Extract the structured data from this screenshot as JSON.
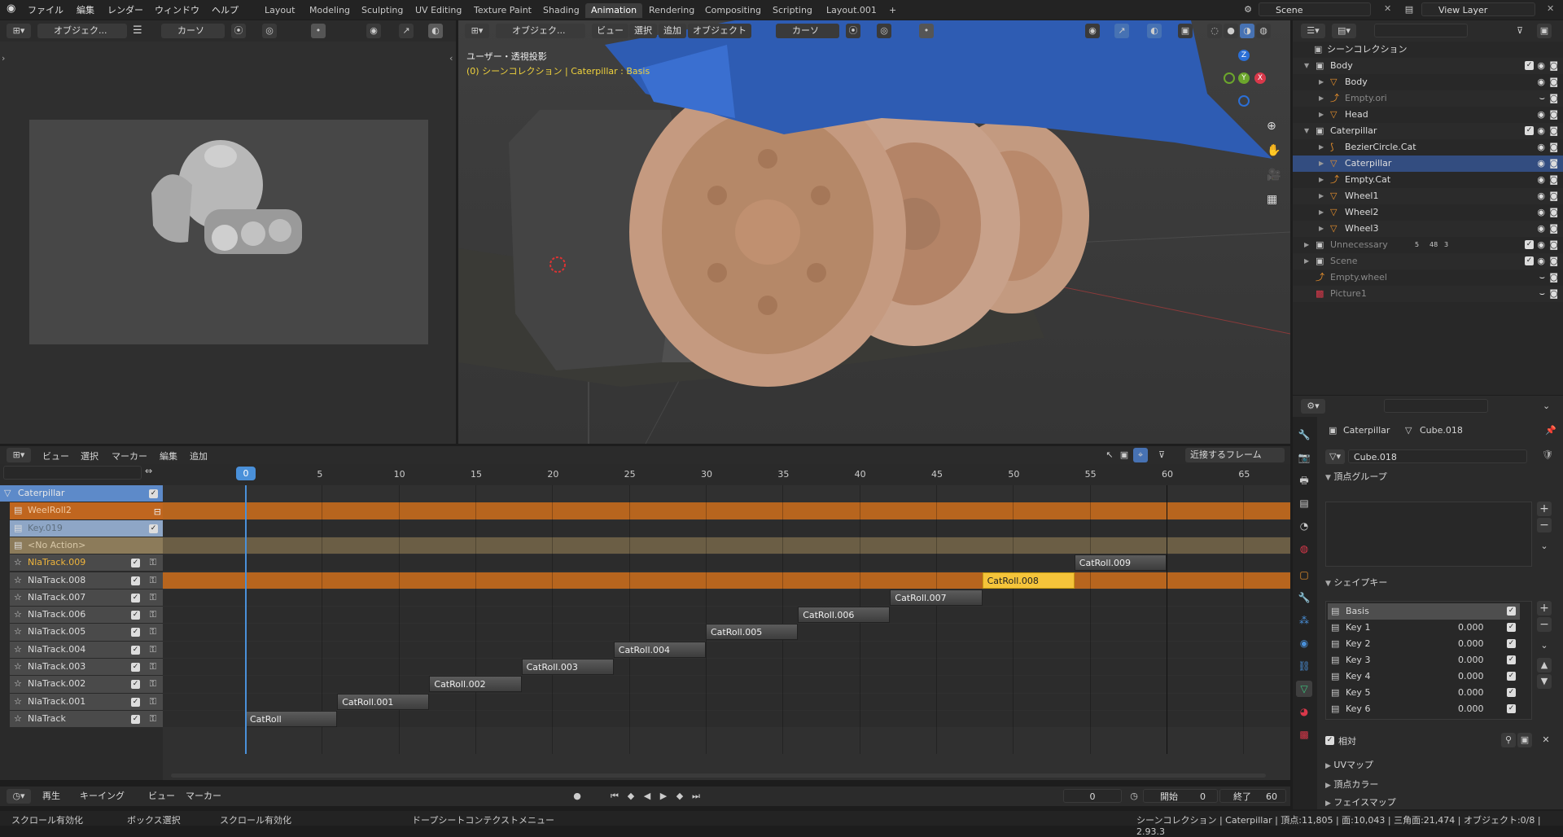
{
  "topbar": {
    "menus": [
      "ファイル",
      "編集",
      "レンダー",
      "ウィンドウ",
      "ヘルプ"
    ],
    "workspaces": [
      "Layout",
      "Modeling",
      "Sculpting",
      "UV Editing",
      "Texture Paint",
      "Shading",
      "Animation",
      "Rendering",
      "Compositing",
      "Scripting",
      "Layout.001"
    ],
    "active_workspace": "Animation",
    "add_tab": "+",
    "scene": "Scene",
    "view_layer": "View Layer"
  },
  "camera_view": {
    "mode": "オブジェク...",
    "pivot": "カーソ"
  },
  "viewport": {
    "mode": "オブジェク...",
    "menus": [
      "ビュー",
      "選択",
      "追加",
      "オブジェクト"
    ],
    "pivot": "カーソ",
    "overlay_title": "ユーザー・透視投影",
    "overlay_sub": "(0) シーンコレクション | Caterpillar : Basis",
    "gizmo": {
      "z": "Z",
      "x": "X",
      "y": "Y"
    }
  },
  "outliner": {
    "search_placeholder": "",
    "root": "シーンコレクション",
    "rows": [
      {
        "label": "Body",
        "level": 1,
        "type": "collection",
        "expanded": true
      },
      {
        "label": "Body",
        "level": 2,
        "type": "mesh"
      },
      {
        "label": "Empty.ori",
        "level": 2,
        "type": "empty",
        "dim": true
      },
      {
        "label": "Head",
        "level": 2,
        "type": "mesh"
      },
      {
        "label": "Caterpillar",
        "level": 1,
        "type": "collection",
        "expanded": true
      },
      {
        "label": "BezierCircle.Cat",
        "level": 2,
        "type": "curve"
      },
      {
        "label": "Caterpillar",
        "level": 2,
        "type": "mesh",
        "active": true
      },
      {
        "label": "Empty.Cat",
        "level": 2,
        "type": "empty"
      },
      {
        "label": "Wheel1",
        "level": 2,
        "type": "mesh"
      },
      {
        "label": "Wheel2",
        "level": 2,
        "type": "mesh"
      },
      {
        "label": "Wheel3",
        "level": 2,
        "type": "mesh"
      },
      {
        "label": "Unnecessary",
        "level": 1,
        "type": "collection",
        "dim": true,
        "badges": [
          "5",
          "48",
          "3"
        ]
      },
      {
        "label": "Scene",
        "level": 1,
        "type": "collection",
        "dim": true
      },
      {
        "label": "Empty.wheel",
        "level": 1,
        "type": "empty",
        "dim": true
      },
      {
        "label": "Picture1",
        "level": 1,
        "type": "image",
        "dim": true
      }
    ]
  },
  "properties": {
    "breadcrumb_object": "Caterpillar",
    "breadcrumb_data": "Cube.018",
    "mesh_name": "Cube.018",
    "vertex_groups": "頂点グループ",
    "shape_keys": "シェイプキー",
    "keys": [
      {
        "name": "Basis",
        "value": ""
      },
      {
        "name": "Key 1",
        "value": "0.000"
      },
      {
        "name": "Key 2",
        "value": "0.000"
      },
      {
        "name": "Key 3",
        "value": "0.000"
      },
      {
        "name": "Key 4",
        "value": "0.000"
      },
      {
        "name": "Key 5",
        "value": "0.000"
      },
      {
        "name": "Key 6",
        "value": "0.000"
      }
    ],
    "relative": "相対",
    "uv_maps": "UVマップ",
    "vertex_colors": "頂点カラー",
    "face_maps": "フェイスマップ"
  },
  "nla": {
    "menus": [
      "ビュー",
      "選択",
      "マーカー",
      "編集",
      "追加"
    ],
    "snap": "近接するフレーム",
    "current_frame": "0",
    "ticks": [
      "0",
      "5",
      "10",
      "15",
      "20",
      "25",
      "30",
      "35",
      "40",
      "45",
      "50",
      "55",
      "60",
      "65"
    ],
    "channels": [
      {
        "label": "Caterpillar",
        "kind": "object"
      },
      {
        "label": "WeelRoll2",
        "kind": "action"
      },
      {
        "label": "Key.019",
        "kind": "shapekey"
      },
      {
        "label": "<No Action>",
        "kind": "noaction"
      },
      {
        "label": "NlaTrack.009",
        "kind": "track",
        "active": true
      },
      {
        "label": "NlaTrack.008",
        "kind": "track"
      },
      {
        "label": "NlaTrack.007",
        "kind": "track"
      },
      {
        "label": "NlaTrack.006",
        "kind": "track"
      },
      {
        "label": "NlaTrack.005",
        "kind": "track"
      },
      {
        "label": "NlaTrack.004",
        "kind": "track"
      },
      {
        "label": "NlaTrack.003",
        "kind": "track"
      },
      {
        "label": "NlaTrack.002",
        "kind": "track"
      },
      {
        "label": "NlaTrack.001",
        "kind": "track"
      },
      {
        "label": "NlaTrack",
        "kind": "track"
      }
    ],
    "strips": [
      {
        "name": "CatRoll.009",
        "start": 54,
        "end": 60,
        "row": 4
      },
      {
        "name": "CatRoll.008",
        "start": 48,
        "end": 54,
        "row": 5,
        "selected": true
      },
      {
        "name": "CatRoll.007",
        "start": 42,
        "end": 48,
        "row": 6
      },
      {
        "name": "CatRoll.006",
        "start": 36,
        "end": 42,
        "row": 7
      },
      {
        "name": "CatRoll.005",
        "start": 30,
        "end": 36,
        "row": 8
      },
      {
        "name": "CatRoll.004",
        "start": 24,
        "end": 30,
        "row": 9
      },
      {
        "name": "CatRoll.003",
        "start": 18,
        "end": 24,
        "row": 10
      },
      {
        "name": "CatRoll.002",
        "start": 12,
        "end": 18,
        "row": 11
      },
      {
        "name": "CatRoll.001",
        "start": 6,
        "end": 12,
        "row": 12
      },
      {
        "name": "CatRoll",
        "start": 0,
        "end": 6,
        "row": 13
      }
    ]
  },
  "timeline": {
    "menus": [
      "再生",
      "キーイング",
      "ビュー",
      "マーカー"
    ],
    "frame": "0",
    "start_label": "開始",
    "start": "0",
    "end_label": "終了",
    "end": "60"
  },
  "status": {
    "left": [
      "スクロール有効化",
      "ボックス選択",
      "スクロール有効化",
      "ドープシートコンテクストメニュー"
    ],
    "right": "シーンコレクション | Caterpillar | 頂点:11,805 | 面:10,043 | 三角面:21,474 | オブジェクト:0/8 | 2.93.3"
  },
  "colors": {
    "accent": "#4772b3",
    "selected_strip": "#f5c43a",
    "action_orange": "#c0661f",
    "timeline_blue": "#4a90d9"
  }
}
